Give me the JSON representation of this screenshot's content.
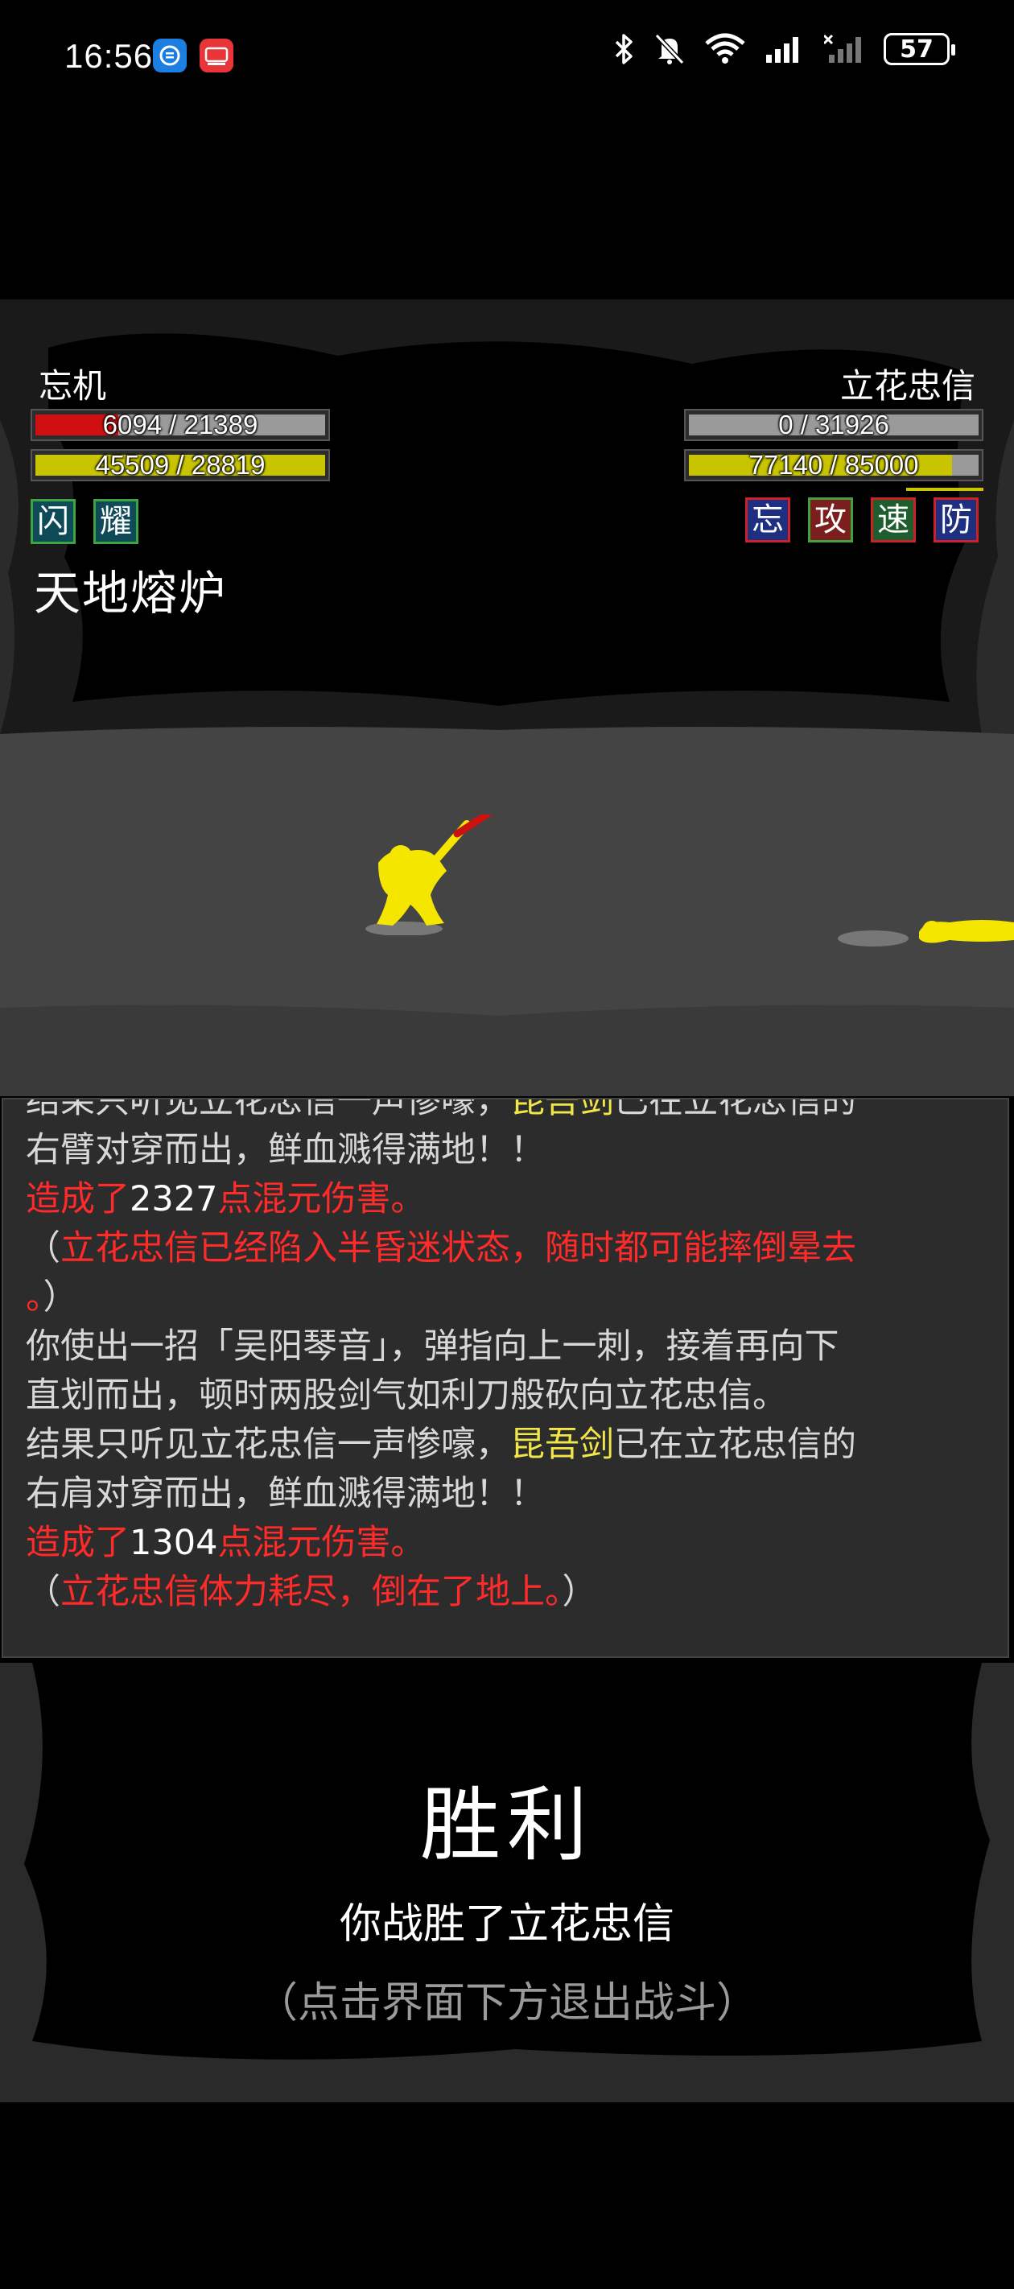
{
  "status_bar": {
    "time": "16:56",
    "battery": "57",
    "apps": [
      "notification-app-icon",
      "huawei-app-icon"
    ],
    "icons": [
      "bluetooth-icon",
      "mute-icon",
      "wifi-icon",
      "signal-icon",
      "signal-off-icon"
    ]
  },
  "player": {
    "name": "忘机",
    "hp_text": "6094 / 21389",
    "hp_fraction": 0.285,
    "mp_text": "45509 / 28819",
    "mp_fraction": 1.0,
    "buffs": [
      {
        "label": "闪",
        "border": "#3fa33f",
        "bg": "#0e4a58"
      },
      {
        "label": "耀",
        "border": "#3fa33f",
        "bg": "#0e4a58"
      }
    ]
  },
  "enemy": {
    "name": "立花忠信",
    "hp_text": "0 / 31926",
    "hp_fraction": 0.0,
    "mp_text": "77140 / 85000",
    "mp_fraction": 0.907,
    "buffs": [
      {
        "label": "忘",
        "border": "#cc2222",
        "bg": "#1e2e80"
      },
      {
        "label": "攻",
        "border": "#3fa33f",
        "bg": "#7a1e1e"
      },
      {
        "label": "速",
        "border": "#cc2222",
        "bg": "#1e5e2e"
      },
      {
        "label": "防",
        "border": "#cc2222",
        "bg": "#1e2e80"
      }
    ]
  },
  "location": "天地熔炉",
  "battle_log": [
    [
      {
        "t": "结果只听见立花忠信一声惨嚎，",
        "c": ""
      },
      {
        "t": "昆吾剑",
        "c": "yellow"
      },
      {
        "t": "已在立花忠信的",
        "c": ""
      }
    ],
    [
      {
        "t": "右臂对穿而出，鲜血溅得满地！！",
        "c": ""
      }
    ],
    [
      {
        "t": "造成了",
        "c": "red"
      },
      {
        "t": "2327",
        "c": "white"
      },
      {
        "t": "点混元伤害。",
        "c": "red"
      }
    ],
    [
      {
        "t": "（",
        "c": ""
      },
      {
        "t": "立花忠信已经陷入半昏迷状态，随时都可能摔倒晕去",
        "c": "red"
      }
    ],
    [
      {
        "t": "。",
        "c": "red"
      },
      {
        "t": "）",
        "c": ""
      }
    ],
    [
      {
        "t": "你使出一招「吴阳琴音」，弹指向上一刺，接着再向下",
        "c": ""
      }
    ],
    [
      {
        "t": "直划而出，顿时两股剑气如利刀般砍向立花忠信。",
        "c": ""
      }
    ],
    [
      {
        "t": "结果只听见立花忠信一声惨嚎，",
        "c": ""
      },
      {
        "t": "昆吾剑",
        "c": "yellow"
      },
      {
        "t": "已在立花忠信的",
        "c": ""
      }
    ],
    [
      {
        "t": "右肩对穿而出，鲜血溅得满地！！",
        "c": ""
      }
    ],
    [
      {
        "t": "造成了",
        "c": "red"
      },
      {
        "t": "1304",
        "c": "white"
      },
      {
        "t": "点混元伤害。",
        "c": "red"
      }
    ],
    [
      {
        "t": "（",
        "c": ""
      },
      {
        "t": "立花忠信体力耗尽，倒在了地上。",
        "c": "red"
      },
      {
        "t": "）",
        "c": ""
      }
    ]
  ],
  "result": {
    "title": "胜利",
    "message": "你战胜了立花忠信",
    "hint": "（点击界面下方退出战斗）"
  },
  "colors": {
    "hp_fill": "#d01010",
    "mp_fill": "#c8c400",
    "log_red": "#ff2a2a",
    "log_yellow": "#f0e64a",
    "fighter": "#f5e600"
  }
}
